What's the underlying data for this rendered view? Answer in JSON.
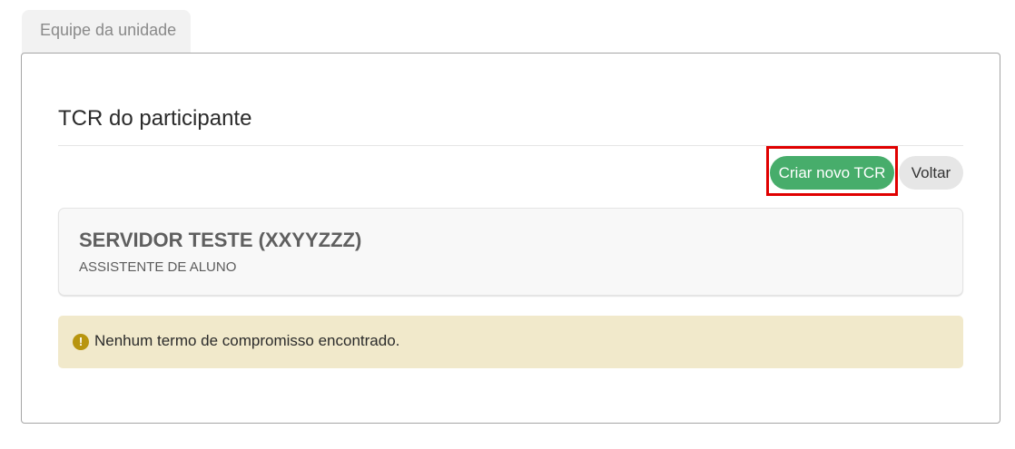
{
  "tabs": [
    {
      "label": "Equipe da unidade"
    }
  ],
  "page": {
    "title": "TCR do participante"
  },
  "actions": {
    "create_label": "Criar novo TCR",
    "back_label": "Voltar"
  },
  "participant": {
    "name": "SERVIDOR TESTE (XXYYZZZ)",
    "role": "ASSISTENTE DE ALUNO"
  },
  "alert": {
    "icon": "exclamation-circle-icon",
    "message": "Nenhum termo de compromisso encontrado."
  },
  "colors": {
    "primary_button": "#47ad6b",
    "secondary_button": "#e6e6e6",
    "highlight_border": "#e00000",
    "alert_background": "#f1e9cb",
    "alert_icon": "#b8950f"
  }
}
